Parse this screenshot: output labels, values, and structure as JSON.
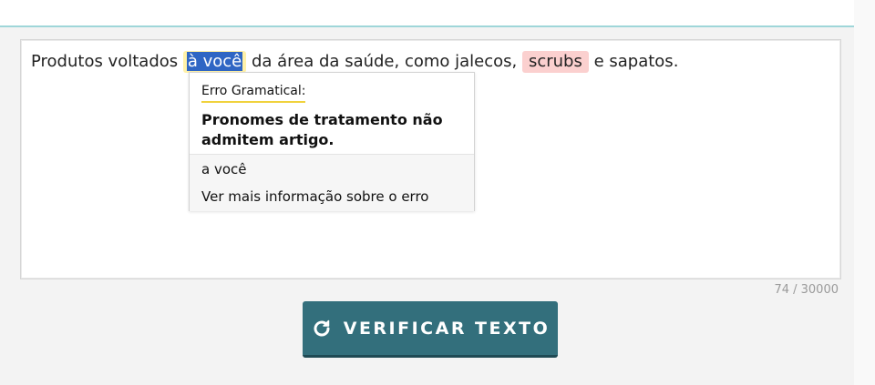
{
  "editor": {
    "text_before": "Produtos voltados ",
    "grammar_error": "à você",
    "text_middle": " da área da saúde, como jalecos, ",
    "spelling_error": "scrubs",
    "text_after": " e sapatos."
  },
  "popup": {
    "error_type": "Erro Gramatical:",
    "message": "Pronomes de tratamento não admitem artigo.",
    "suggestion": "a você",
    "more_info": "Ver mais informação sobre o erro"
  },
  "counter": "74 / 30000",
  "verify_button": {
    "label": "VERIFICAR TEXTO",
    "icon": "refresh-icon"
  },
  "colors": {
    "accent_line": "#9fd6d9",
    "grammar_highlight": "#fff1a8",
    "spelling_highlight": "#fbd0cf",
    "selection": "#2f66c4",
    "button": "#336f7c"
  }
}
